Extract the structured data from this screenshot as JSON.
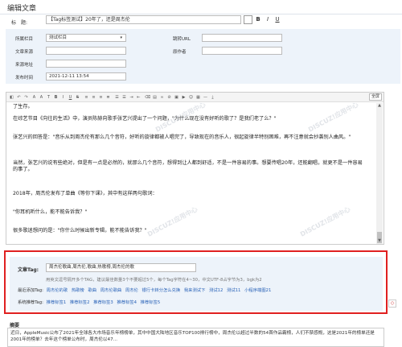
{
  "page_title": "编辑文章",
  "title_row": {
    "label": "标　题:",
    "value": "【Tag标签测试】20年了，还是周杰伦",
    "bold_label": "B",
    "italic_label": "I",
    "underline_label": "U"
  },
  "meta": {
    "category_label": "所属栏目",
    "category_value": "测试栏目",
    "source_label": "文章来源",
    "source_value": "",
    "origin_url_label": "来源地址",
    "origin_url_value": "",
    "publish_time_label": "发布时间",
    "publish_time_value": "2021-12-11 13:54",
    "jump_url_label": "跳转URL",
    "jump_url_value": "",
    "author_label": "原作者",
    "author_value": ""
  },
  "editor": {
    "fullscreen_label": "全屏",
    "paragraphs": [
      "了生存。",
      "在综艺节目《向往的生活》中，演员陈赫向歌手张艺兴提出了一个问题，\"为什么现在没有好听的歌了？是我们老了么？\"",
      "张艺兴的回答是：\"音乐从到周杰伦有那么几个音符，好听的旋律都被人唱完了，导致现在的音乐人，很起旋律半特别困难，再不注意就会抄袭别人曲风。\"",
      "当然，张艺兴的说有些绝对，但是有一点是必然的，就那么几个音符，想得到让人都到舒适，不是一件容易的事。想要传唱20年，还能翻唱，就更不是一件容易的事了。",
      "2018年，周杰伦发布了单曲《等你下课》，其中有这样两句歌词：",
      "\"你耳机听什么，能不能告诉我？\"",
      "很多歌迷想问的是：\"你什么时候出新专辑，能不能告诉我？\""
    ]
  },
  "tags": {
    "label": "文章Tag:",
    "value": "周杰伦歌曲,周杰伦,歌曲,热歌榜,周杰伦的歌",
    "help": "用英文逗号隔开多个TAG，建议最佳数量3个不要超过5个，每个Tag字符在4~30，中文UTF-8占字节为3，bgk为2",
    "recent_label": "最近添加Tag:",
    "recent_tags": [
      "周杰伦的歌",
      "热歌榜",
      "歌曲",
      "周杰伦歌曲",
      "周杰伦",
      "银行卡转分怎么兑换",
      "我来测试下",
      "测试12",
      "测试11",
      "小程序端图21"
    ],
    "system_label": "系统推荐Tag:",
    "system_tags": [
      "推荐标签1",
      "推荐标签2",
      "推荐标签3",
      "推荐标签4",
      "推荐标签5"
    ]
  },
  "summary": {
    "label": "摘要",
    "text": "近日，AppleMusic公布了2021年全球各大市场音乐年榜榜单，其中中国大陆地区音乐TOP100排行榜中，周杰伦以超过半数的54首作品霸榜，人们不禁感慨，这是2021年的榜单还是2001年的榜单？去年这个榜单公布时，周杰伦以47..."
  }
}
